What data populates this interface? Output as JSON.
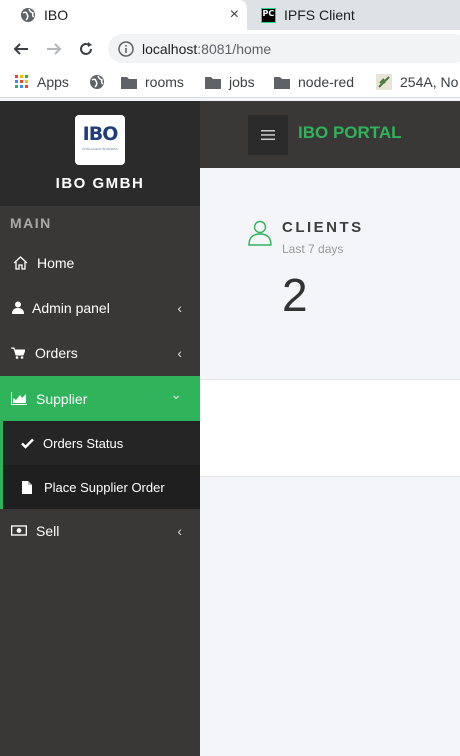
{
  "browser": {
    "tabs": [
      {
        "title": "IBO",
        "close": "×"
      },
      {
        "title": "IPFS Client",
        "favicon": "PC"
      }
    ],
    "url": {
      "host": "localhost",
      "rest": ":8081/home"
    },
    "bookmarks": [
      "Apps",
      "rooms",
      "jobs",
      "node-red",
      "254A, No"
    ]
  },
  "sidebar": {
    "logo_text": "IBO",
    "logo_sub": "INTELLIGENT BUSINESS",
    "brand": "IBO GMBH",
    "section": "MAIN",
    "items": [
      {
        "label": "Home",
        "icon": "home-icon"
      },
      {
        "label": "Admin panel",
        "icon": "user-icon",
        "chevron": "‹"
      },
      {
        "label": "Orders",
        "icon": "cart-icon",
        "chevron": "‹"
      },
      {
        "label": "Supplier",
        "icon": "area-chart-icon",
        "chevron": "⌄"
      },
      {
        "label": "Sell",
        "icon": "money-icon",
        "chevron": "‹"
      }
    ],
    "subitems": [
      {
        "label": "Orders Status",
        "icon": "check-icon"
      },
      {
        "label": "Place Supplier Order",
        "icon": "file-icon"
      }
    ]
  },
  "header": {
    "title": "IBO PORTAL"
  },
  "card": {
    "title": "CLIENTS",
    "subtitle": "Last 7 days",
    "value": "2"
  },
  "colors": {
    "accent": "#2fb35b",
    "sidebar": "#3a3836",
    "brand_bg": "#2b2b2b"
  }
}
